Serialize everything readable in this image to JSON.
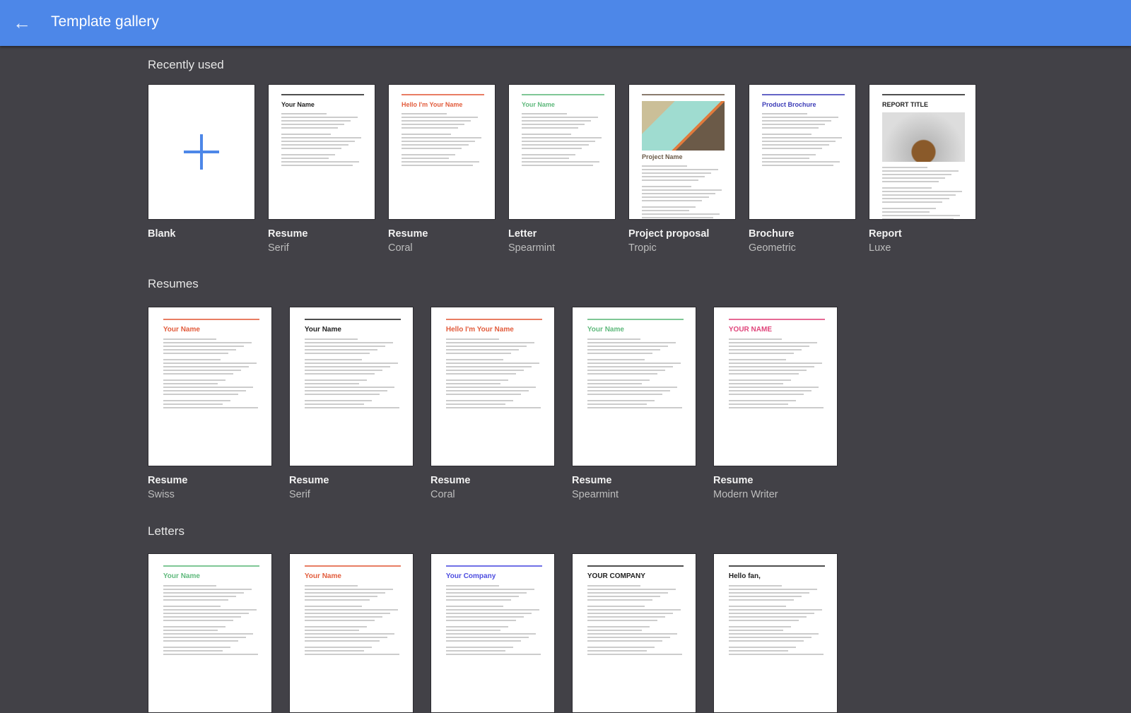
{
  "header": {
    "title": "Template gallery",
    "back_icon": "arrow-left-icon"
  },
  "colors": {
    "header": "#4d87e8",
    "background": "#424147",
    "accent_blue": "#4d87e8"
  },
  "sections": [
    {
      "title": "Recently used",
      "items": [
        {
          "name": "Blank",
          "subtitle": "",
          "heading": "",
          "accent": "#4d87e8"
        },
        {
          "name": "Resume",
          "subtitle": "Serif",
          "heading": "Your Name",
          "accent": "#222222"
        },
        {
          "name": "Resume",
          "subtitle": "Coral",
          "heading": "Hello I'm Your Name",
          "accent": "#e25c3c"
        },
        {
          "name": "Letter",
          "subtitle": "Spearmint",
          "heading": "Your Name",
          "accent": "#5fb97c"
        },
        {
          "name": "Project proposal",
          "subtitle": "Tropic",
          "heading": "Project Name",
          "accent": "#6b5a48"
        },
        {
          "name": "Brochure",
          "subtitle": "Geometric",
          "heading": "Product Brochure",
          "accent": "#3d3db8"
        },
        {
          "name": "Report",
          "subtitle": "Luxe",
          "heading": "REPORT TITLE",
          "accent": "#222222"
        }
      ]
    },
    {
      "title": "Resumes",
      "items": [
        {
          "name": "Resume",
          "subtitle": "Swiss",
          "heading": "Your Name",
          "accent": "#e25c3c"
        },
        {
          "name": "Resume",
          "subtitle": "Serif",
          "heading": "Your Name",
          "accent": "#222222"
        },
        {
          "name": "Resume",
          "subtitle": "Coral",
          "heading": "Hello I'm Your Name",
          "accent": "#e25c3c"
        },
        {
          "name": "Resume",
          "subtitle": "Spearmint",
          "heading": "Your Name",
          "accent": "#5fb97c"
        },
        {
          "name": "Resume",
          "subtitle": "Modern Writer",
          "heading": "YOUR NAME",
          "accent": "#e0457b"
        }
      ]
    },
    {
      "title": "Letters",
      "items": [
        {
          "name": "",
          "subtitle": "",
          "heading": "Your Name",
          "accent": "#5fb97c"
        },
        {
          "name": "",
          "subtitle": "",
          "heading": "Your Name",
          "accent": "#e25c3c"
        },
        {
          "name": "",
          "subtitle": "",
          "heading": "Your Company",
          "accent": "#4d4de0"
        },
        {
          "name": "",
          "subtitle": "",
          "heading": "YOUR COMPANY",
          "accent": "#222222"
        },
        {
          "name": "",
          "subtitle": "",
          "heading": "Hello fan,",
          "accent": "#222222"
        }
      ]
    }
  ]
}
